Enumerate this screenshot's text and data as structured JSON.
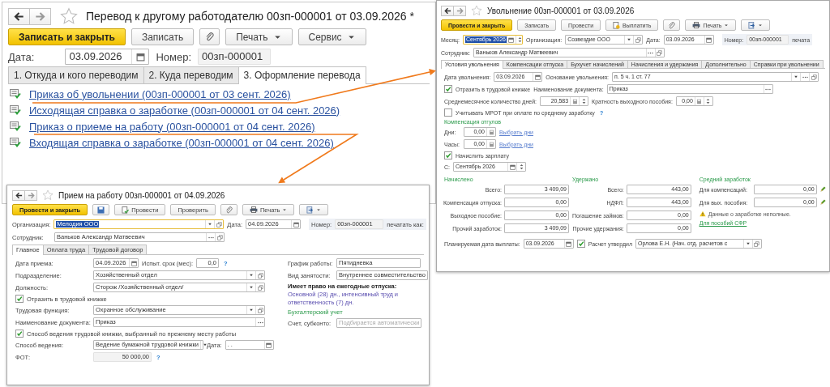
{
  "transfer": {
    "title": "Перевод к другому работодателю 00зп-000001 от 03.09.2026 *",
    "toolbar": [
      {
        "kind": "primary",
        "label": "Записать и закрыть"
      },
      {
        "kind": "plain",
        "label": "Записать"
      },
      {
        "kind": "attach"
      },
      {
        "kind": "menu",
        "label": "Печать"
      },
      {
        "kind": "menu",
        "label": "Сервис"
      }
    ],
    "date": {
      "label": "Дата:",
      "value": "03.09.2026"
    },
    "number": {
      "label": "Номер:",
      "value": "00зп-000001"
    },
    "tabs": [
      {
        "label": "1. Откуда и кого переводим",
        "selected": false
      },
      {
        "label": "2. Куда переводим",
        "selected": false
      },
      {
        "label": "3. Оформление перевода",
        "selected": true
      }
    ],
    "documents": [
      "Приказ об увольнении (00зп-000001 от 03 сент. 2026)",
      "Исходящая справка о заработке (00зп-000001 от 04 сент. 2026)",
      "Приказ о приеме на работу (00зп-000001 от 04 сент. 2026)",
      "Входящая справка о заработке (00зп-000001 от 04 сент. 2026)"
    ]
  },
  "dismissal": {
    "title": "Увольнение 00зп-000001 от 03.09.2026",
    "toolbar": [
      {
        "kind": "primary",
        "label": "Провести и закрыть"
      },
      {
        "kind": "plain",
        "label": "Записать"
      },
      {
        "kind": "plain",
        "label": "Провести"
      },
      {
        "kind": "pay",
        "label": "Выплатить"
      },
      {
        "kind": "attach"
      },
      {
        "kind": "print",
        "label": "Печать"
      },
      {
        "kind": "icon_menu"
      }
    ],
    "month": {
      "label": "Месяц:",
      "value": "Сентябрь 2026",
      "text_selected": true
    },
    "organization": {
      "label": "Организация:",
      "value": "Созвездие ООО"
    },
    "date": {
      "label": "Дата:",
      "value": "03.09.2026"
    },
    "number": {
      "label": "Номер:",
      "value": "00зп-000001"
    },
    "print_as_label": "печата",
    "employee": {
      "label": "Сотрудник:",
      "value": "Ваньков Александр Матвеевич"
    },
    "tabs": [
      {
        "label": "Условия увольнения",
        "selected": true
      },
      {
        "label": "Компенсации отпуска",
        "selected": false
      },
      {
        "label": "Бухучет начислений",
        "selected": false
      },
      {
        "label": "Начисления и удержания",
        "selected": false
      },
      {
        "label": "Дополнительно",
        "selected": false
      },
      {
        "label": "Справки при увольнении",
        "selected": false
      }
    ],
    "dismissal_date": {
      "label": "Дата увольнения:",
      "value": "03.09.2026"
    },
    "dismissal_basis": {
      "label": "Основание увольнения:",
      "value": "п. 5 ч. 1 ст. 77"
    },
    "reflect_in_workbook": {
      "label": "Отразить в трудовой книжке",
      "checked": true
    },
    "document_name": {
      "label": "Наименование документа:",
      "value": "Приказ"
    },
    "avg_days": {
      "label": "Среднемесячное количество дней:",
      "value": "20,583"
    },
    "severance_multiple": {
      "label": "Кратность выходного пособия:",
      "value": "0,00"
    },
    "use_mrot": {
      "label": "Учитывать МРОТ при оплате по среднему заработку",
      "checked": false,
      "help": "?"
    },
    "time_off_compensation": {
      "heading": "Компенсация отгулов",
      "rows": [
        {
          "label": "Дни:",
          "value": "0,00",
          "link": "Выбрать дни"
        },
        {
          "label": "Часы:",
          "value": "0,00",
          "link": "Выбрать дни"
        }
      ]
    },
    "accrue_salary": {
      "label": "Начислить зарплату",
      "checked": true
    },
    "from": {
      "label": "С:",
      "value": "Сентябрь 2026"
    },
    "accrued": {
      "heading": "Начислено",
      "rows": [
        {
          "label": "Всего:",
          "value": "3 409,09"
        },
        {
          "label": "Компенсация отпуска:",
          "value": "0,00"
        },
        {
          "label": "Выходное пособие:",
          "value": "0,00"
        },
        {
          "label": "Прочий заработок:",
          "value": "3 409,09"
        }
      ]
    },
    "withheld": {
      "heading": "Удержано",
      "rows": [
        {
          "label": "Всего:",
          "value": "443,00"
        },
        {
          "label": "НДФЛ:",
          "value": "443,00"
        },
        {
          "label": "Погашение займов:",
          "value": "0,00"
        },
        {
          "label": "Прочие удержания:",
          "value": "0,00"
        }
      ]
    },
    "average_earnings": {
      "heading": "Средний заработок",
      "rows": [
        {
          "label": "Для компенсаций:",
          "value": "0,00"
        },
        {
          "label": "Для вых. пособия:",
          "value": "0,00"
        }
      ],
      "warning": "Данные о заработке неполные.",
      "link": "Для пособий СФР"
    },
    "planned_payment_date": {
      "label": "Планируемая дата выплаты:",
      "value": "03.09.2026"
    },
    "approved": {
      "label": "Расчет утвердил",
      "checked": true,
      "value": "Орлова Е.Н. (Нач. отд. расчетов с"
    }
  },
  "hiring": {
    "title": "Прием на работу 00зп-000001 от 04.09.2026",
    "toolbar": [
      {
        "kind": "primary",
        "label": "Провести и закрыть"
      },
      {
        "kind": "save"
      },
      {
        "kind": "post",
        "label": "Провести"
      },
      {
        "kind": "plain",
        "label": "Проверить"
      },
      {
        "kind": "attach"
      },
      {
        "kind": "print",
        "label": "Печать"
      },
      {
        "kind": "icon_menu"
      }
    ],
    "organization": {
      "label": "Организация:",
      "value": "Мелодия ООО",
      "text_selected": true
    },
    "date": {
      "label": "Дата:",
      "value": "04.09.2026"
    },
    "number": {
      "label": "Номер:",
      "value": "00зп-000001"
    },
    "print_as_label": "печатать как:",
    "employee": {
      "label": "Сотрудник:",
      "value": "Ваньков Александр Матвеевич"
    },
    "tabs": [
      {
        "label": "Главное",
        "selected": true
      },
      {
        "label": "Оплата труда",
        "selected": false
      },
      {
        "label": "Трудовой договор",
        "selected": false
      }
    ],
    "hire_date": {
      "label": "Дата приема:",
      "value": "04.09.2026"
    },
    "probation": {
      "label": "Испыт. срок (мес):",
      "value": "0,0",
      "help": "?"
    },
    "department": {
      "label": "Подразделение:",
      "value": "Хозяйственный отдел"
    },
    "position": {
      "label": "Должность:",
      "value": "Сторож /Хозяйственный отдел/"
    },
    "reflect_in_workbook": {
      "label": "Отразить в трудовой книжке",
      "checked": true
    },
    "labor_function": {
      "label": "Трудовая функция:",
      "value": "Охранное обслуживание"
    },
    "document_name": {
      "label": "Наименование документа:",
      "value": "Приказ"
    },
    "keep_workbook_method": {
      "label": "Способ ведения трудовой книжки, выбранный по прежнему месту работы",
      "checked": true
    },
    "method": {
      "label": "Способ ведения:",
      "value": "Ведение бумажной трудовой книжки"
    },
    "method_date": {
      "label": "Дата:",
      "value": " .  ."
    },
    "payroll_fund": {
      "label": "ФОТ:",
      "value": "50 000,00",
      "help": "?"
    },
    "schedule": {
      "label": "График работы:",
      "value": "Пятидневка"
    },
    "employment_type": {
      "label": "Вид занятости:",
      "value": "Внутреннее совместительство"
    },
    "vacation_rights": {
      "label": "Имеет право на ежегодные отпуска:",
      "link": "Основной (28) дн., интенсивный труд и ответственность (7) дн."
    },
    "accounting": {
      "heading": "Бухгалтерский учет",
      "label": "Счет, субконто:",
      "placeholder": "Подбирается автоматически"
    }
  }
}
